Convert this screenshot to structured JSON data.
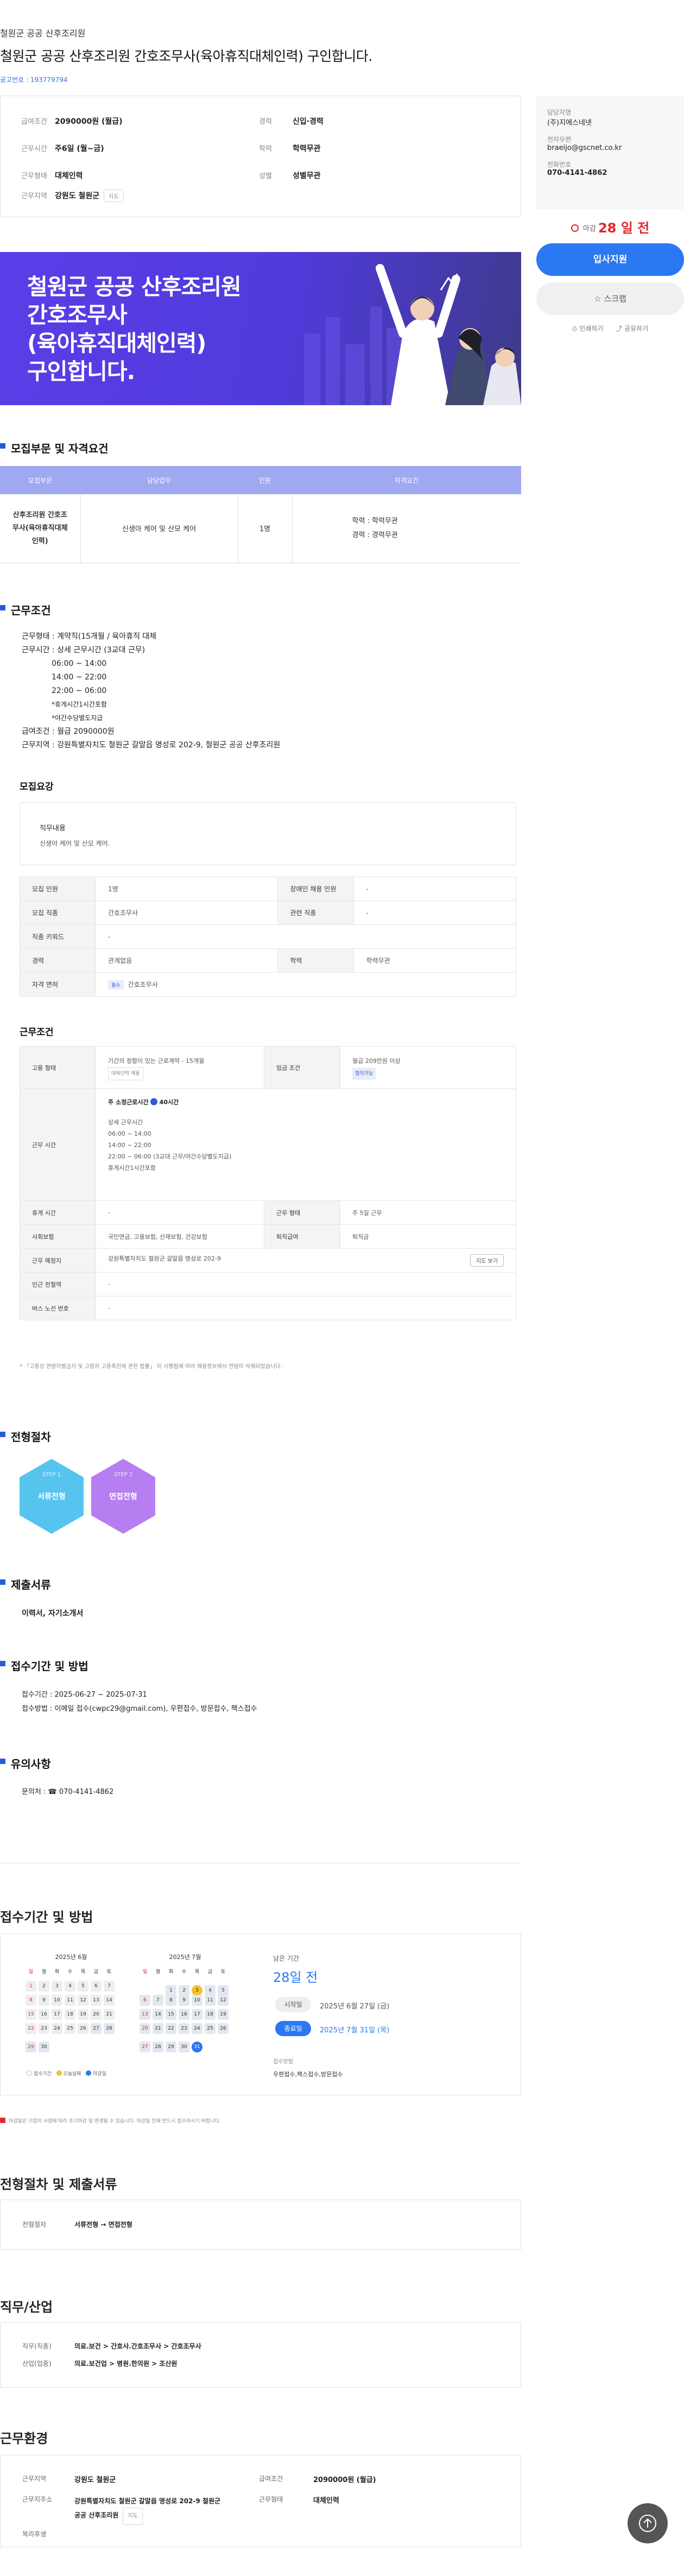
{
  "header": {
    "company": "철원군 공공 산후조리원",
    "title": "철원군 공공 산후조리원 간호조무사(육아휴직대체인력) 구인합니다.",
    "job_number": "공고번호 : 193779794"
  },
  "summary": {
    "salary_label": "급여조건",
    "salary": "2090000원 (월급)",
    "hours_label": "근무시간",
    "hours": "주6일 (월~금)",
    "type_label": "근무형태",
    "type": "대체인력",
    "area_label": "근무지역",
    "area": "강원도 철원군",
    "map_badge": "지도",
    "career_label": "경력",
    "career": "신입·경력",
    "edu_label": "학력",
    "edu": "학력무관",
    "gender_label": "성별",
    "gender": "성별무관"
  },
  "contact": {
    "manager_label": "담당자명",
    "manager": "(주)지에스네넷",
    "email_label": "전자우편",
    "email": "braeijo@gscnet.co.kr",
    "phone_label": "전화번호",
    "phone": "070-4141-4862"
  },
  "sidebar": {
    "deadline_prefix": "마감",
    "deadline_days": "28 일 전",
    "apply": "입사지원",
    "scrap": "스크랩",
    "print": "인쇄하기",
    "share": "공유하기"
  },
  "banner": {
    "line1": "철원군 공공 산후조리원",
    "line2": "간호조무사",
    "line3": "(육아휴직대체인력)",
    "line4": "구인합니다."
  },
  "recruit": {
    "heading": "모집부문 및 자격요건",
    "columns": [
      "모집부문",
      "담당업무",
      "인원",
      "자격요건"
    ],
    "part": "산후조리원 간호조무사(육아휴직대체인력)",
    "duty": "신생아 케어 및 산모 케어",
    "count": "1명",
    "req1": "학력 : 학력무관",
    "req2": "경력 : 경력무관"
  },
  "conditions": {
    "heading": "근무조건",
    "lines": [
      "근무형태 : 계약직(15개월 / 육아휴직 대체",
      "근무시간 : 상세 근무시간 (3교대 근무)",
      "06:00 ~ 14:00",
      "14:00 ~ 22:00",
      "22:00 ~ 06:00",
      "*휴게시간1시간포함",
      "*야간수당별도지급",
      "급여조건 : 월급 2090000원",
      "근무지역 : 강원특별자치도 철원군 갈말읍 명성로 202-9, 철원군 공공 산후조리원"
    ]
  },
  "outline": {
    "heading": "모집요강",
    "duty_label": "직무내용",
    "duty_value": "신생아 케어 및 산모 케어.",
    "rows": [
      {
        "k": "모집 인원",
        "v": "1명",
        "k2": "장애인 채용 인원",
        "v2": "-"
      },
      {
        "k": "모집 직종",
        "v": "간호조무사",
        "k2": "관련 직종",
        "v2": "-"
      },
      {
        "k": "직종 키워드",
        "v": "-",
        "k2": "",
        "v2": ""
      },
      {
        "k": "경력",
        "v": "관계없음",
        "k2": "학력",
        "v2": "학력무관"
      },
      {
        "k": "자격 면허",
        "v": "간호조무사",
        "badge": "필수",
        "k2": "",
        "v2": ""
      }
    ]
  },
  "workcond": {
    "heading": "근무조건",
    "employ_label": "고용 형태",
    "employ_value": "기간의 정함이 있는 근로계약 - 15개월",
    "employ_tag": "대체인력 채용",
    "wage_label": "임금 조건",
    "wage_value": "월급 209만원 이상",
    "wage_tag": "협의가능",
    "hours_label": "근무 시간",
    "hours_week": "주 소정근로시간",
    "hours_week_val": "40시간",
    "hours_lines": [
      "상세 근무시간",
      "06:00 ~ 14:00",
      "14:00 ~ 22:00",
      "22:00 ~ 06:00 (3교대 근무/야간수당별도지급)",
      "휴게시간1시간포함"
    ],
    "rest_label": "휴게 시간",
    "rest_value": "-",
    "daytype_label": "근무 형태",
    "daytype_value": "주 5일 근무",
    "insurance_label": "사회보험",
    "insurance_value": "국민연금, 고용보험, 산재보험, 건강보험",
    "retire_label": "퇴직급여",
    "retire_value": "퇴직금",
    "place_label": "근무 예정지",
    "place_value": "강원특별자치도 철원군 갈말읍 명성로 202-9",
    "place_btn": "지도 보기",
    "station_label": "인근 전철역",
    "station_value": "-",
    "bus_label": "버스 노선 번호",
    "bus_value": "-",
    "note": "* 「고용상 연령차별금지 및 고령자 고용촉진에 관한 법률」 이 시행됨에 따라 채용정보에서 연령이 삭제되었습니다."
  },
  "process": {
    "heading": "전형절차",
    "step1_num": "STEP 1",
    "step1": "서류전형",
    "step2_num": "STEP 2",
    "step2": "면접전형"
  },
  "docs": {
    "heading": "제출서류",
    "value": "이력서, 자기소개서"
  },
  "period": {
    "heading": "접수기간 및 방법",
    "line1": "접수기간 : 2025-06-27 ~ 2025-07-31",
    "line2": "접수방법 : 이메일 접수(cwpc29@gmail.com), 우편접수, 방문접수, 팩스접수"
  },
  "notice": {
    "heading": "유의사항",
    "phone": "문의처 : ☎ 070-4141-4862"
  },
  "apply_section": {
    "heading": "접수기간 및 방법",
    "cal1_title": "2025년 6월",
    "cal2_title": "2025년 7월",
    "weekdays": [
      "일",
      "월",
      "화",
      "수",
      "목",
      "금",
      "토"
    ],
    "legend1": "접수기간",
    "legend2": "오늘날짜",
    "legend3": "마감일",
    "remain_label": "남은 기간",
    "remain": "28일 전",
    "start_label": "시작일",
    "start": "2025년 6월 27일 (금)",
    "end_label": "종료일",
    "end": "2025년 7월 31일 (목)",
    "method_label": "접수방법",
    "method": "우편접수,팩스접수,방문접수",
    "warn": "마감일은 기업의 사정에 따라 조기마감 및 변경될 수 있습니다. 마감일 전에 반드시 접수하시기 바랍니다."
  },
  "process2": {
    "heading": "전형절차 및 제출서류",
    "label": "전형절차",
    "value": "서류전형 → 면접전형"
  },
  "industry": {
    "heading": "직무/산업",
    "job_label": "직무(직종)",
    "job_value": "의료.보건 > 간호사.간호조무사 > 간호조무사",
    "ind_label": "산업(업종)",
    "ind_value": "의료.보건업 > 병원.한의원 > 조산원"
  },
  "env": {
    "heading": "근무환경",
    "area_label": "근무지역",
    "area": "강원도 철원군",
    "salary_label": "급여조건",
    "salary": "2090000원 (월급)",
    "addr_label": "근무지주소",
    "addr1": "강원특별자치도 철원군 갈말읍 명성로 202-9 철원군",
    "addr2": "공공 산후조리원",
    "map_badge": "지도",
    "type_label": "근무형태",
    "type": "대체인력",
    "welfare_label": "복리후생"
  },
  "colors": {
    "accent": "#2a78f2",
    "deadline": "#e0262c",
    "banner": "#5a3ee8"
  }
}
